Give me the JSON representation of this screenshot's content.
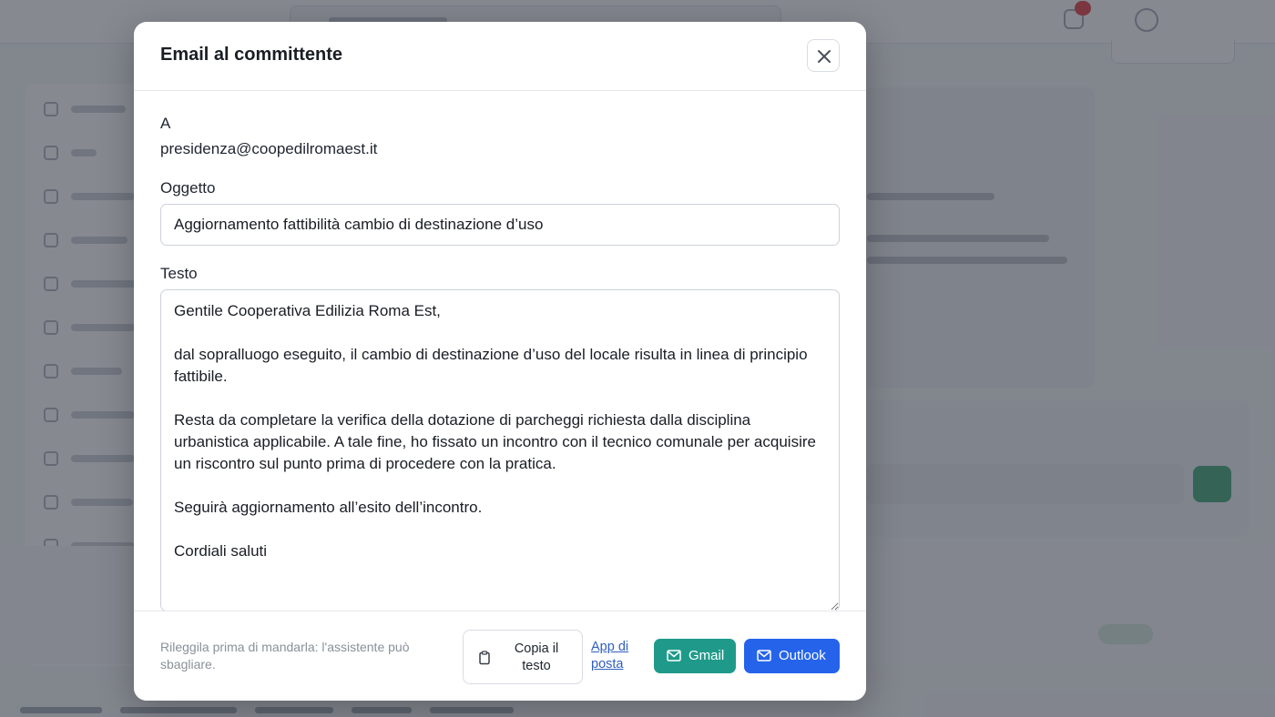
{
  "modal": {
    "title": "Email al committente",
    "to_label": "A",
    "to_value": "presidenza@coopedilromaest.it",
    "subject_label": "Oggetto",
    "subject_value": "Aggiornamento fattibilità cambio di destinazione d’uso",
    "body_label": "Testo",
    "body_value": "Gentile Cooperativa Edilizia Roma Est,\n\ndal sopralluogo eseguito, il cambio di destinazione d’uso del locale risulta in linea di principio fattibile.\n\nResta da completare la verifica della dotazione di parcheggi richiesta dalla disciplina urbanistica applicabile. A tale fine, ho fissato un incontro con il tecnico comunale per acquisire un riscontro sul punto prima di procedere con la pratica.\n\nSeguirà aggiornamento all’esito dell’incontro.\n\nCordiali saluti",
    "footer": {
      "note": "Rileggila prima di mandarla: l'assistente può sbagliare.",
      "copy_label": "Copia il testo",
      "app_link_label": "App di posta",
      "gmail_label": "Gmail",
      "outlook_label": "Outlook"
    }
  },
  "icons": {
    "close": "close-icon",
    "copy": "clipboard-icon",
    "mail": "mail-icon"
  },
  "colors": {
    "gmail_button": "#1f9a8a",
    "outlook_button": "#2563eb",
    "link": "#2f5fbf",
    "overlay": "#3c404c"
  }
}
